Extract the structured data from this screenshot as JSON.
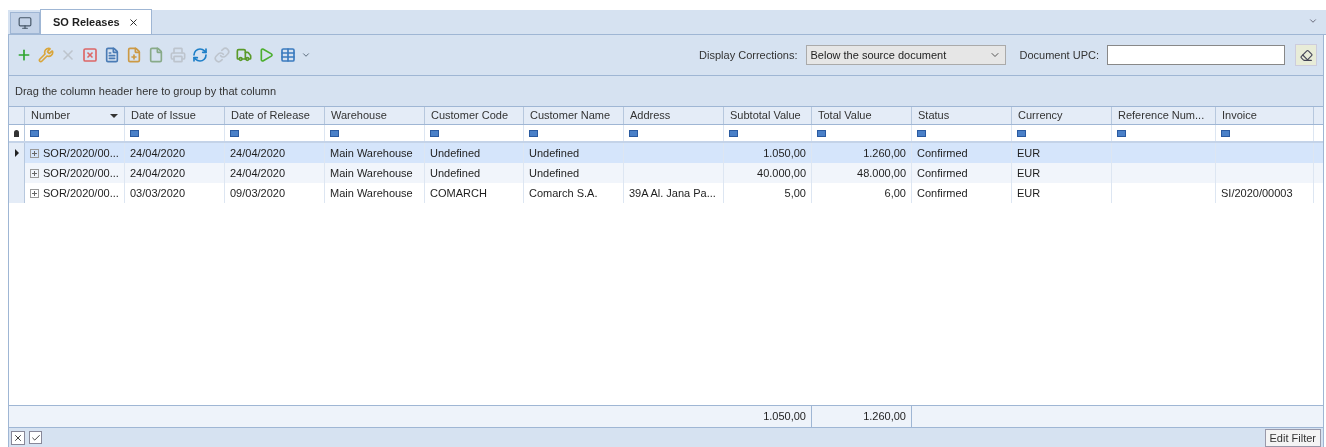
{
  "tabs": [
    {
      "label": "SO Releases",
      "selected": true
    }
  ],
  "toolbar": [
    {
      "kind": "add",
      "disabled": false
    },
    {
      "kind": "edit",
      "disabled": false
    },
    {
      "kind": "delete",
      "disabled": true
    },
    {
      "kind": "cancel",
      "disabled": false
    },
    {
      "kind": "copy",
      "disabled": false
    },
    {
      "kind": "generate",
      "disabled": false
    },
    {
      "kind": "document",
      "disabled": false
    },
    {
      "kind": "print",
      "disabled": true
    },
    {
      "kind": "refresh",
      "disabled": false
    },
    {
      "kind": "link",
      "disabled": true
    },
    {
      "kind": "truck",
      "disabled": false
    },
    {
      "kind": "run",
      "disabled": false
    },
    {
      "kind": "export",
      "disabled": false
    }
  ],
  "display_corrections": {
    "label": "Display Corrections:",
    "value": "Below the source document"
  },
  "document_upc": {
    "label": "Document UPC:"
  },
  "group_panel": "Drag the column header here to group by that column",
  "table": {
    "columns": [
      {
        "label": "Number",
        "sorted": true
      },
      {
        "label": "Date of Issue",
        "sorted": false
      },
      {
        "label": "Date of Release",
        "sorted": false
      },
      {
        "label": "Warehouse",
        "sorted": false
      },
      {
        "label": "Customer Code",
        "sorted": false
      },
      {
        "label": "Customer Name",
        "sorted": false
      },
      {
        "label": "Address",
        "sorted": false
      },
      {
        "label": "Subtotal Value",
        "sorted": false
      },
      {
        "label": "Total Value",
        "sorted": false
      },
      {
        "label": "Status",
        "sorted": false
      },
      {
        "label": "Currency",
        "sorted": false
      },
      {
        "label": "Reference Num...",
        "sorted": false
      },
      {
        "label": "Invoice",
        "sorted": false
      }
    ],
    "rows": [
      {
        "selected": true,
        "cells": [
          "SOR/2020/00...",
          "24/04/2020",
          "24/04/2020",
          "Main Warehouse",
          "Undefined",
          "Undefined",
          "",
          "1.050,00",
          "1.260,00",
          "Confirmed",
          "EUR",
          "",
          ""
        ]
      },
      {
        "selected": false,
        "cells": [
          "SOR/2020/00...",
          "24/04/2020",
          "24/04/2020",
          "Main Warehouse",
          "Undefined",
          "Undefined",
          "",
          "40.000,00",
          "48.000,00",
          "Confirmed",
          "EUR",
          "",
          ""
        ]
      },
      {
        "selected": false,
        "cells": [
          "SOR/2020/00...",
          "03/03/2020",
          "09/03/2020",
          "Main Warehouse",
          "COMARCH",
          "Comarch S.A.",
          "39A Al. Jana Pa...",
          "5,00",
          "6,00",
          "Confirmed",
          "EUR",
          "",
          "SI/2020/00003"
        ]
      }
    ],
    "totals": {
      "subtotal_value": "1.050,00",
      "total_value": "1.260,00"
    }
  },
  "filter_enabled": {
    "checked": true
  },
  "edit_filter": "Edit Filter"
}
